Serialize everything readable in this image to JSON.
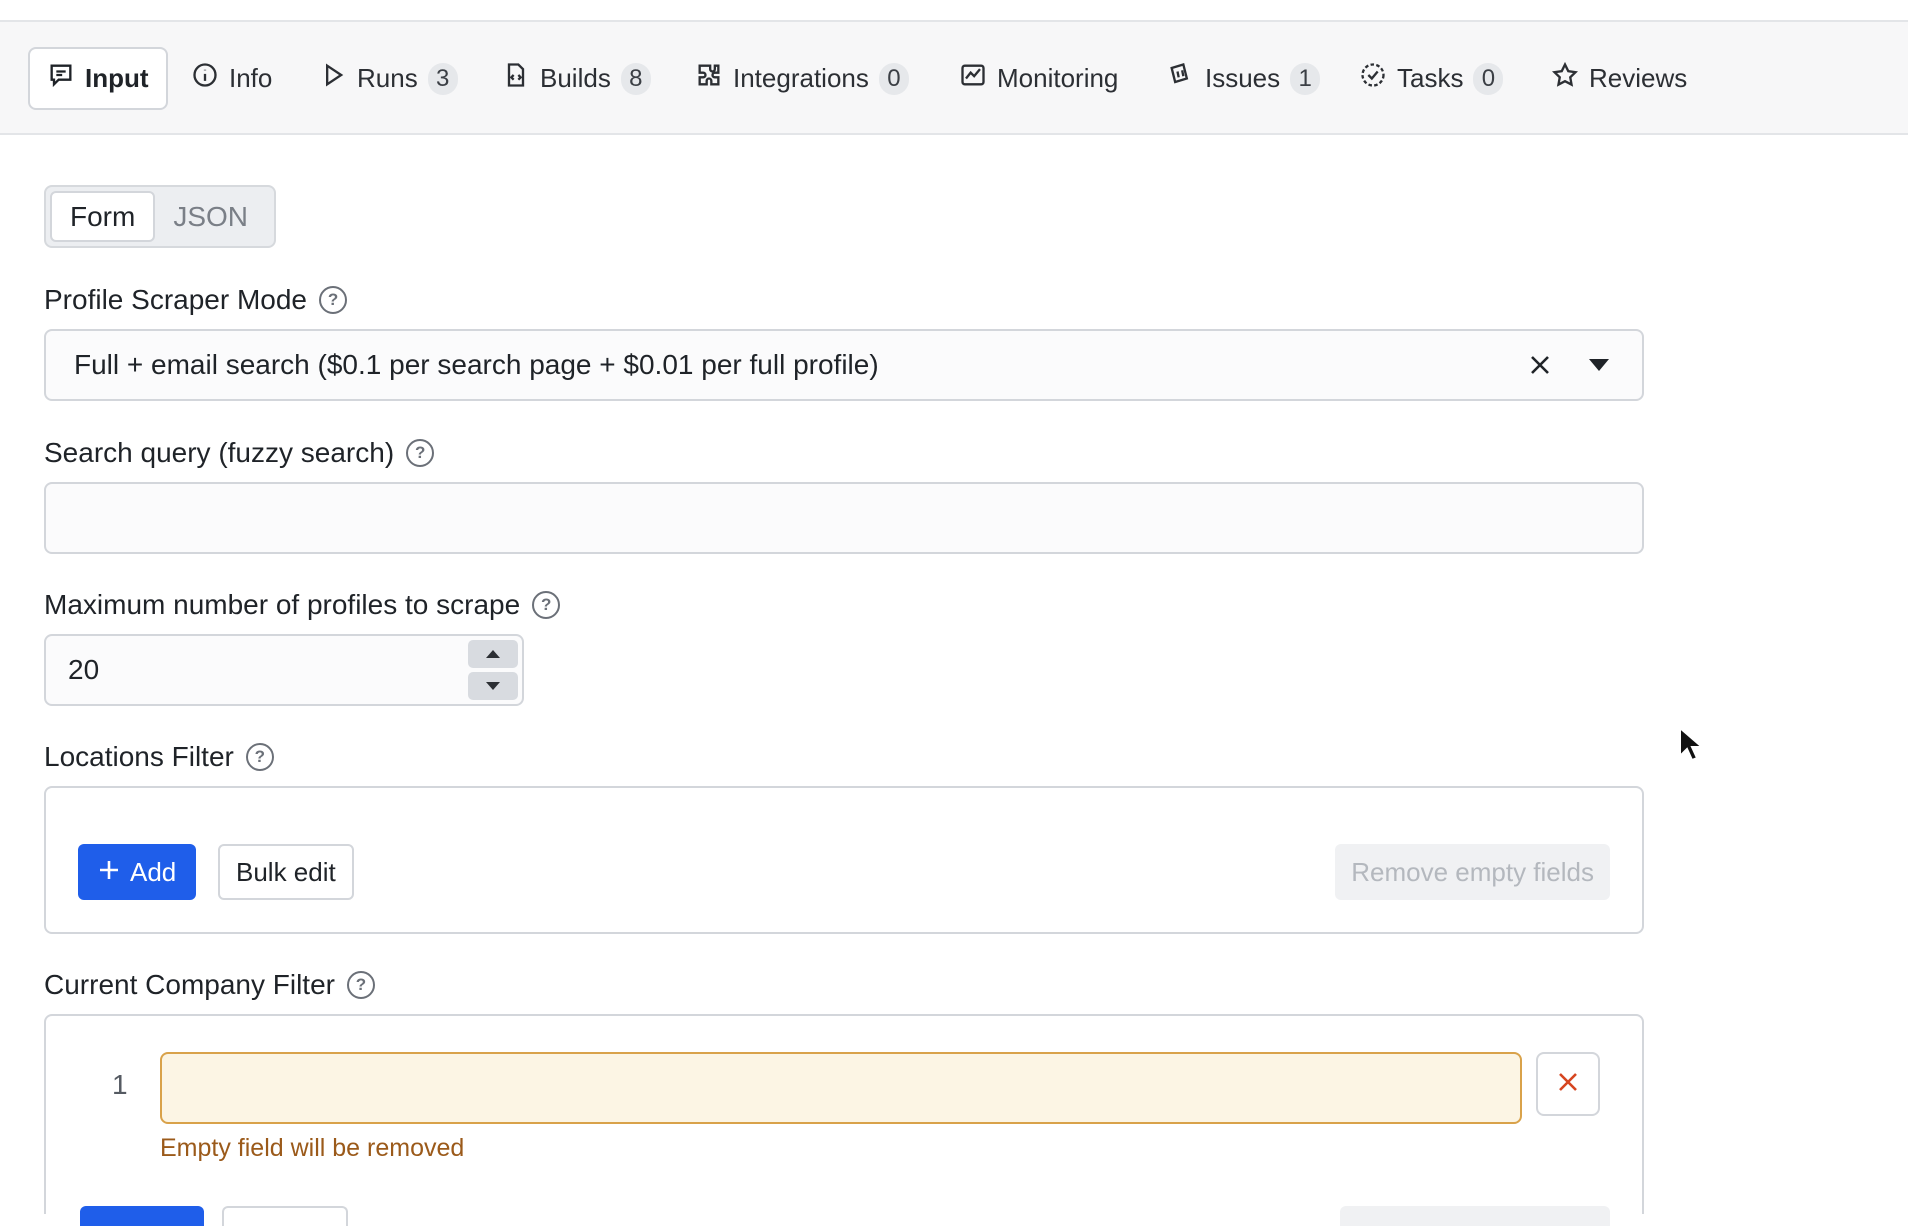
{
  "tabs": [
    {
      "label": "Input",
      "icon": "input-icon",
      "active": true
    },
    {
      "label": "Info",
      "icon": "info-icon"
    },
    {
      "label": "Runs",
      "icon": "play-icon",
      "count": "3"
    },
    {
      "label": "Builds",
      "icon": "file-code-icon",
      "count": "8"
    },
    {
      "label": "Integrations",
      "icon": "puzzle-icon",
      "count": "0"
    },
    {
      "label": "Monitoring",
      "icon": "chart-icon"
    },
    {
      "label": "Issues",
      "icon": "issues-icon",
      "count": "1"
    },
    {
      "label": "Tasks",
      "icon": "tasks-icon",
      "count": "0"
    },
    {
      "label": "Reviews",
      "icon": "star-icon"
    }
  ],
  "mode_toggle": {
    "form": "Form",
    "json": "JSON",
    "selected": "Form"
  },
  "fields": {
    "profile_mode": {
      "label": "Profile Scraper Mode",
      "value": "Full + email search ($0.1 per search page + $0.01 per full profile)"
    },
    "search_query": {
      "label": "Search query (fuzzy search)",
      "value": ""
    },
    "max_profiles": {
      "label": "Maximum number of profiles to scrape",
      "value": "20"
    },
    "locations": {
      "label": "Locations Filter",
      "add_label": "Add",
      "bulk_label": "Bulk edit",
      "remove_empty_label": "Remove empty fields"
    },
    "current_company": {
      "label": "Current Company Filter",
      "row_number": "1",
      "row_value": "",
      "warning": "Empty field will be removed"
    }
  },
  "colors": {
    "primary": "#1f5eea",
    "warning_border": "#d9a24a",
    "warning_bg": "#fcf5e4",
    "warning_text": "#9b5a1a",
    "danger_icon": "#d6451f"
  }
}
